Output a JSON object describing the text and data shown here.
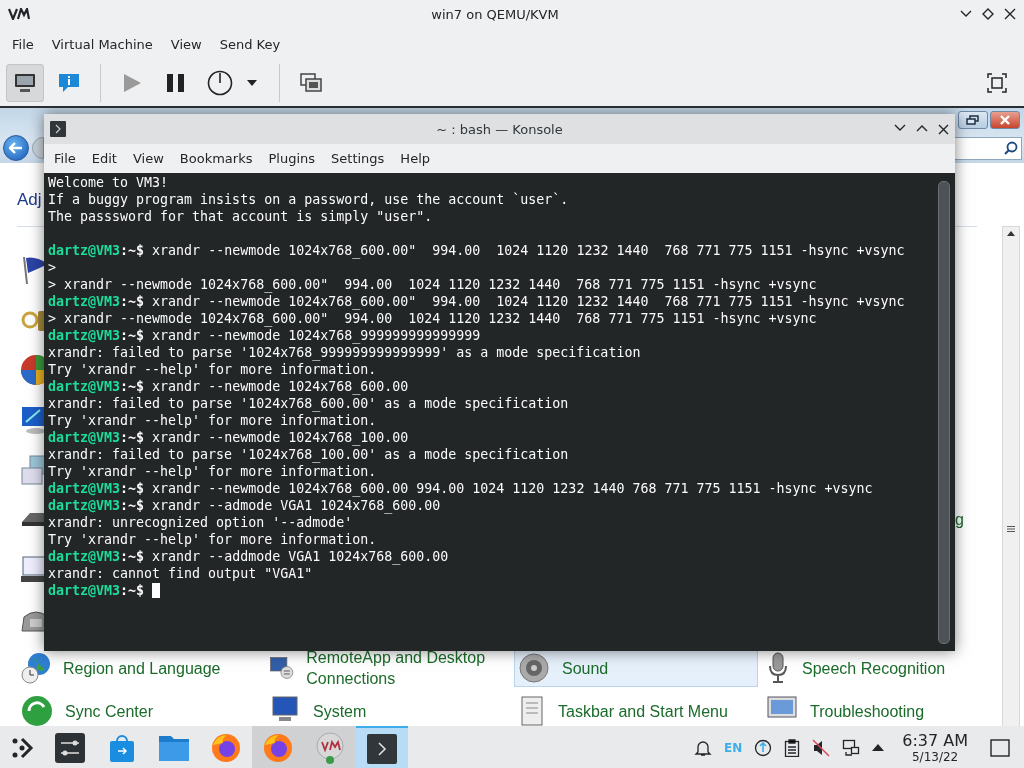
{
  "window": {
    "title": "win7 on QEMU/KVM"
  },
  "menu": [
    "File",
    "Virtual Machine",
    "View",
    "Send Key"
  ],
  "toolbar": [
    {
      "kind": "console",
      "selected": true
    },
    {
      "kind": "details",
      "selected": false
    },
    {
      "kind": "separator"
    },
    {
      "kind": "run",
      "disabled": true
    },
    {
      "kind": "pause",
      "disabled": false
    },
    {
      "kind": "power",
      "disabled": false
    },
    {
      "kind": "dropdown",
      "disabled": false
    },
    {
      "kind": "separator"
    },
    {
      "kind": "snapshots"
    }
  ],
  "guest": {
    "heading": "Adj",
    "fragment": "g",
    "items": [
      {
        "label": "Region and Language",
        "selected": false
      },
      {
        "label": "RemoteApp and Desktop Connections",
        "selected": false
      },
      {
        "label": "Sound",
        "selected": true
      },
      {
        "label": "Speech Recognition",
        "selected": false
      },
      {
        "label": "Sync Center",
        "selected": false
      },
      {
        "label": "System",
        "selected": false
      },
      {
        "label": "Taskbar and Start Menu",
        "selected": false
      },
      {
        "label": "Troubleshooting",
        "selected": false
      }
    ]
  },
  "konsole": {
    "title": "~ : bash — Konsole",
    "menu": [
      "File",
      "Edit",
      "View",
      "Bookmarks",
      "Plugins",
      "Settings",
      "Help"
    ],
    "lines": [
      {
        "kind": "output",
        "text": "Welcome to VM3!"
      },
      {
        "kind": "output",
        "text": "If a buggy program insists on a password, use the account `user`."
      },
      {
        "kind": "output",
        "text": "The passsword for that account is simply \"user\"."
      },
      {
        "kind": "blank"
      },
      {
        "kind": "prompt",
        "user": "dartz@VM3",
        "tail": ":~$",
        "command": "xrandr --newmode 1024x768_600.00\"  994.00  1024 1120 1232 1440  768 771 775 1151 -hsync +vsync"
      },
      {
        "kind": "output",
        "text": ">"
      },
      {
        "kind": "output",
        "text": "> xrandr --newmode 1024x768_600.00\"  994.00  1024 1120 1232 1440  768 771 775 1151 -hsync +vsync"
      },
      {
        "kind": "prompt",
        "user": "dartz@VM3",
        "tail": ":~$",
        "command": "xrandr --newmode 1024x768_600.00\"  994.00  1024 1120 1232 1440  768 771 775 1151 -hsync +vsync"
      },
      {
        "kind": "output",
        "text": "> xrandr --newmode 1024x768_600.00\"  994.00  1024 1120 1232 1440  768 771 775 1151 -hsync +vsync"
      },
      {
        "kind": "prompt",
        "user": "dartz@VM3",
        "tail": ":~$",
        "command": "xrandr --newmode 1024x768_999999999999999"
      },
      {
        "kind": "output",
        "text": "xrandr: failed to parse '1024x768_999999999999999' as a mode specification"
      },
      {
        "kind": "output",
        "text": "Try 'xrandr --help' for more information."
      },
      {
        "kind": "prompt",
        "user": "dartz@VM3",
        "tail": ":~$",
        "command": "xrandr --newmode 1024x768_600.00"
      },
      {
        "kind": "output",
        "text": "xrandr: failed to parse '1024x768_600.00' as a mode specification"
      },
      {
        "kind": "output",
        "text": "Try 'xrandr --help' for more information."
      },
      {
        "kind": "prompt",
        "user": "dartz@VM3",
        "tail": ":~$",
        "command": "xrandr --newmode 1024x768_100.00"
      },
      {
        "kind": "output",
        "text": "xrandr: failed to parse '1024x768_100.00' as a mode specification"
      },
      {
        "kind": "output",
        "text": "Try 'xrandr --help' for more information."
      },
      {
        "kind": "prompt",
        "user": "dartz@VM3",
        "tail": ":~$",
        "command": "xrandr --newmode 1024x768_600.00 994.00 1024 1120 1232 1440 768 771 775 1151 -hsync +vsync"
      },
      {
        "kind": "prompt",
        "user": "dartz@VM3",
        "tail": ":~$",
        "command": "xrandr --admode VGA1 1024x768_600.00"
      },
      {
        "kind": "output",
        "text": "xrandr: unrecognized option '--admode'"
      },
      {
        "kind": "output",
        "text": "Try 'xrandr --help' for more information."
      },
      {
        "kind": "prompt",
        "user": "dartz@VM3",
        "tail": ":~$",
        "command": "xrandr --addmode VGA1 1024x768_600.00"
      },
      {
        "kind": "output",
        "text": "xrandr: cannot find output \"VGA1\""
      },
      {
        "kind": "prompt",
        "user": "dartz@VM3",
        "tail": ":~$",
        "cursor": true
      }
    ]
  },
  "taskbar": {
    "tasks": [
      {
        "kind": "launcher",
        "open": false,
        "selected": false
      },
      {
        "kind": "settings",
        "open": false,
        "selected": false
      },
      {
        "kind": "store",
        "open": false,
        "selected": false
      },
      {
        "kind": "files",
        "open": false,
        "selected": false
      },
      {
        "kind": "firefox",
        "open": false,
        "selected": false
      },
      {
        "kind": "firefox",
        "open": true,
        "selected": false
      },
      {
        "kind": "vm",
        "open": true,
        "selected": false
      },
      {
        "kind": "terminal",
        "open": true,
        "selected": true
      }
    ],
    "language": "EN",
    "time": "6:37 AM",
    "date": "5/13/22"
  }
}
